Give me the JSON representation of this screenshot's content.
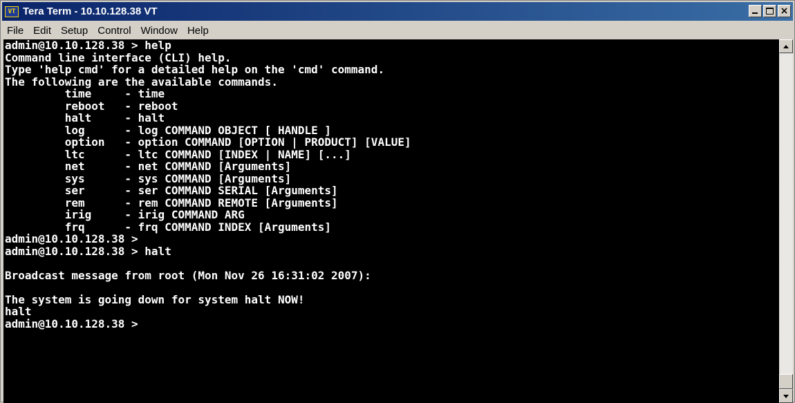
{
  "window": {
    "title": "Tera Term - 10.10.128.38 VT",
    "app_icon_text": "VT",
    "controls": {
      "minimize": "minimize-icon",
      "maximize": "maximize-icon",
      "close": "×"
    }
  },
  "menu": [
    {
      "label": "File"
    },
    {
      "label": "Edit"
    },
    {
      "label": "Setup"
    },
    {
      "label": "Control"
    },
    {
      "label": "Window"
    },
    {
      "label": "Help"
    }
  ],
  "terminal": {
    "background": "#000000",
    "foreground": "#ffffff",
    "lines": [
      "admin@10.10.128.38 > help",
      "Command line interface (CLI) help.",
      "Type 'help cmd' for a detailed help on the 'cmd' command.",
      "The following are the available commands.",
      "         time     - time",
      "         reboot   - reboot",
      "         halt     - halt",
      "         log      - log COMMAND OBJECT [ HANDLE ]",
      "         option   - option COMMAND [OPTION | PRODUCT] [VALUE]",
      "         ltc      - ltc COMMAND [INDEX | NAME] [...]",
      "         net      - net COMMAND [Arguments]",
      "         sys      - sys COMMAND [Arguments]",
      "         ser      - ser COMMAND SERIAL [Arguments]",
      "         rem      - rem COMMAND REMOTE [Arguments]",
      "         irig     - irig COMMAND ARG",
      "         frq      - frq COMMAND INDEX [Arguments]",
      "admin@10.10.128.38 >",
      "admin@10.10.128.38 > halt",
      "",
      "Broadcast message from root (Mon Nov 26 16:31:02 2007):",
      "",
      "The system is going down for system halt NOW!",
      "halt",
      "admin@10.10.128.38 >"
    ]
  },
  "scrollbar": {
    "up_icon": "arrow-up-icon",
    "down_icon": "arrow-down-icon",
    "thumb_position": 1.0
  }
}
